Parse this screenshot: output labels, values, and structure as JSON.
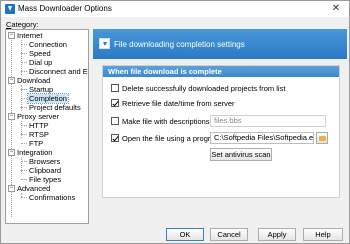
{
  "window": {
    "title": "Mass Downloader Options",
    "close_glyph": "✕"
  },
  "sidebar": {
    "category_label_prefix": "C",
    "category_label_rest": "ategory:",
    "tree": [
      {
        "label": "Internet",
        "level": 0,
        "expander": "−"
      },
      {
        "label": "Connection",
        "level": 1
      },
      {
        "label": "Speed",
        "level": 1
      },
      {
        "label": "Dial up",
        "level": 1
      },
      {
        "label": "Disconnect and Exit",
        "level": 1
      },
      {
        "label": "Download",
        "level": 0,
        "expander": "−"
      },
      {
        "label": "Startup",
        "level": 1
      },
      {
        "label": "Completion",
        "level": 1,
        "selected": true
      },
      {
        "label": "Project defaults",
        "level": 1
      },
      {
        "label": "Proxy server",
        "level": 0,
        "expander": "−"
      },
      {
        "label": "HTTP",
        "level": 1
      },
      {
        "label": "RTSP",
        "level": 1
      },
      {
        "label": "FTP",
        "level": 1
      },
      {
        "label": "Integration",
        "level": 0,
        "expander": "−"
      },
      {
        "label": "Browsers",
        "level": 1
      },
      {
        "label": "Clipboard",
        "level": 1
      },
      {
        "label": "File types",
        "level": 1
      },
      {
        "label": "Advanced",
        "level": 0,
        "expander": "−"
      },
      {
        "label": "Confirmations",
        "level": 1
      }
    ]
  },
  "header": {
    "title": "File downloading completion settings",
    "icon": "download-arrow-icon"
  },
  "panel": {
    "title": "When file download is complete",
    "options": {
      "delete_projects": {
        "label": "Delete successfully downloaded projects from list",
        "checked": false
      },
      "retrieve_datetime": {
        "label": "Retrieve file date/time from server",
        "checked": true
      },
      "make_descriptions": {
        "label": "Make file with descriptions:",
        "checked": false,
        "field_value": "files.bbs"
      },
      "open_program": {
        "label": "Open the file using a program:",
        "checked": true,
        "field_value": "C:\\Softpedia Files\\Softpedia.exe"
      }
    },
    "antivirus_button": "Set antivirus scan"
  },
  "footer": {
    "ok": "OK",
    "cancel": "Cancel",
    "apply": "Apply",
    "help": "Help"
  },
  "colors": {
    "header_band": "#2b7ac4",
    "selection": "#cde6f7"
  }
}
